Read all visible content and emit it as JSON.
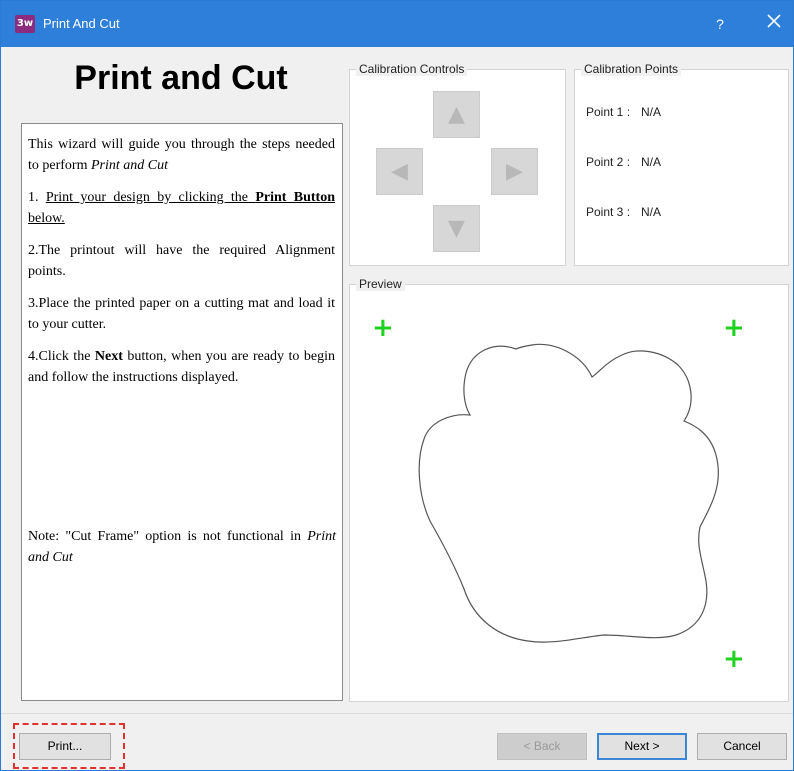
{
  "window": {
    "title": "Print And Cut",
    "help_label": "?",
    "colors": {
      "titlebar": "#2d7fd9",
      "accent_plus": "#1fd21f",
      "highlight": "#e0322e"
    }
  },
  "wizard": {
    "heading": "Print and Cut",
    "intro_1": "This wizard will guide you through the steps needed to perform ",
    "intro_em": "Print and Cut",
    "step1_num": "1. ",
    "step1_u1": "Print your design by clicking the ",
    "step1_bold": "Print Button",
    "step1_u2": " below.",
    "step2": "2.The printout will have the required Alignment points.",
    "step3": "3.Place the printed paper on a cutting mat and load it to your cutter.",
    "step4_a": "4.Click the ",
    "step4_bold": "Next",
    "step4_b": " button, when you are ready to begin and follow the instructions displayed.",
    "note_a": "Note: \"Cut Frame\" option is not functional in ",
    "note_em": "Print and Cut"
  },
  "calibration_controls": {
    "legend": "Calibration Controls",
    "up": "▲",
    "left": "◀",
    "right": "▶",
    "down": "▼"
  },
  "calibration_points": {
    "legend": "Calibration Points",
    "points": [
      {
        "label": "Point 1 :",
        "value": "N/A"
      },
      {
        "label": "Point 2 :",
        "value": "N/A"
      },
      {
        "label": "Point 3 :",
        "value": "N/A"
      }
    ]
  },
  "preview": {
    "legend": "Preview",
    "marker": "+",
    "shape_icon": "paw-outline-icon"
  },
  "buttons": {
    "print": "Print...",
    "back": "< Back",
    "next": "Next >",
    "cancel": "Cancel"
  }
}
